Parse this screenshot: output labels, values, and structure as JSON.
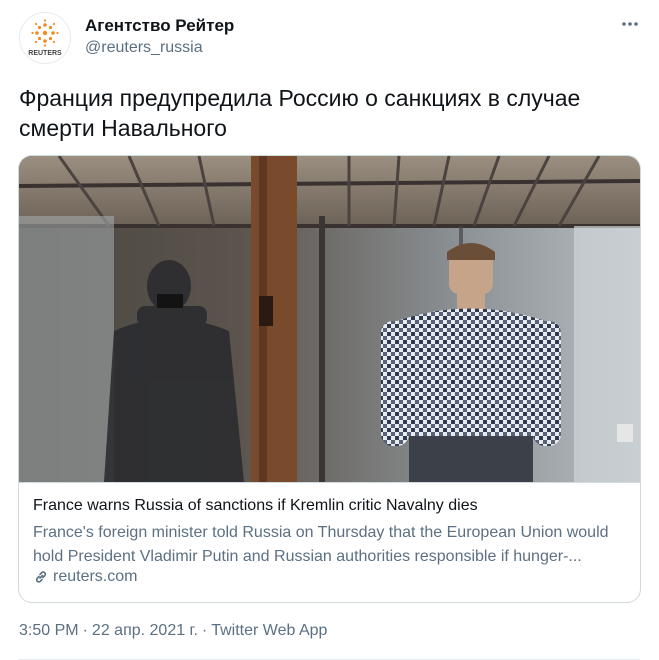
{
  "author": {
    "display_name": "Агентство Рейтер",
    "handle": "@reuters_russia",
    "avatar_logo_text": "REUTERS",
    "avatar_icon": "reuters-logo-icon"
  },
  "menu_icon": "more-options-icon",
  "tweet": {
    "text": "Франция предупредила Россию о санкциях в случае смерти Навального"
  },
  "card": {
    "image_description_icon": "courtroom-photo",
    "title": "France warns Russia of sanctions if Kremlin critic Navalny dies",
    "description": "France's foreign minister told Russia on Thursday that the European Union would hold President Vladimir Putin and Russian authorities responsible if hunger-...",
    "domain": "reuters.com",
    "domain_icon": "link-icon"
  },
  "meta": {
    "time": "3:50 PM",
    "separator": "·",
    "date": "22 апр. 2021 г.",
    "source": "Twitter Web App"
  },
  "colors": {
    "secondary_text": "#5b7083",
    "border": "#cfd9de",
    "reuters_orange": "#f08a24"
  }
}
